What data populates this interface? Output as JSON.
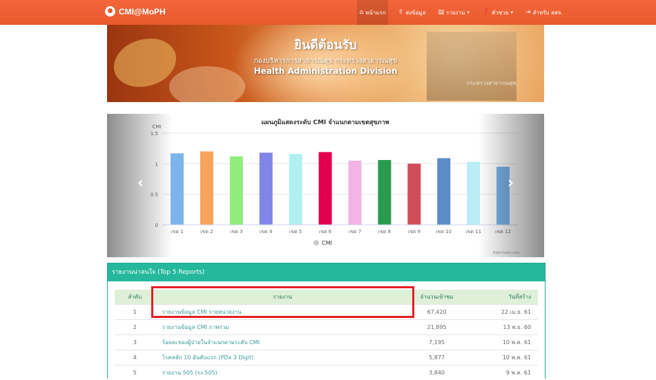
{
  "navbar": {
    "brand": "CMI@MoPH",
    "items": [
      {
        "icon": "home-icon",
        "glyph": "⌂",
        "label": "หน้าแรก",
        "caret": false,
        "active": true
      },
      {
        "icon": "upload-icon",
        "glyph": "⇧",
        "label": "ส่งข้อมูล",
        "caret": false,
        "active": false
      },
      {
        "icon": "file-icon",
        "glyph": "▤",
        "label": "รายงาน",
        "caret": true,
        "active": false
      },
      {
        "icon": "help-icon",
        "glyph": "❓",
        "label": "ตัวช่วย",
        "caret": true,
        "active": false
      },
      {
        "icon": "login-icon",
        "glyph": "⇥",
        "label": "สำหรับ สสจ.",
        "caret": false,
        "active": false
      }
    ]
  },
  "banner": {
    "title": "ยินดีต้อนรับ",
    "subtitle": "กองบริหารการสาธารณสุข กระทรวงสาธารณสุข",
    "english": "Health Administration Division",
    "sign": "กระทรวงสาธารณสุข"
  },
  "chart_data": {
    "type": "bar",
    "title": "แผนภูมิแสดงระดับ CMI จำแนกตามเขตสุขภาพ",
    "ylabel": "CMI",
    "ylim": [
      0,
      1.5
    ],
    "yticks": [
      "0",
      "0.5",
      "1",
      "1.5"
    ],
    "categories": [
      "เขต 1",
      "เขต 2",
      "เขต 3",
      "เขต 4",
      "เขต 5",
      "เขต 6",
      "เขต 7",
      "เขต 8",
      "เขต 9",
      "เขต 10",
      "เขต 11",
      "เขต 12"
    ],
    "values": [
      1.17,
      1.2,
      1.12,
      1.18,
      1.16,
      1.19,
      1.05,
      1.06,
      1.0,
      1.09,
      1.03,
      0.95
    ],
    "colors": [
      "#7cb5ec",
      "#f7a35c",
      "#90ed7d",
      "#8085e9",
      "#b2eff0",
      "#e4004f",
      "#f2b4e6",
      "#2b9a4d",
      "#d14d57",
      "#5b8cc8",
      "#b9ecf4",
      "#7cb5ec"
    ],
    "series": [
      {
        "name": "CMI"
      }
    ],
    "credit": "Highcharts.com",
    "grid": true,
    "legend": "bottom-center"
  },
  "top_reports": {
    "title": "รายงานน่าสนใจ (Top 5 Reports)",
    "headers": {
      "no": "ลำดับ",
      "name": "รายงาน",
      "views": "จำนวนเข้าชม",
      "date": "วันที่สร้าง"
    },
    "rows": [
      {
        "no": "1",
        "name": "รายงานข้อมูล CMI รายหน่วยงาน",
        "views": "67,420",
        "date": "22 เม.ย. 61"
      },
      {
        "no": "2",
        "name": "รายงานข้อมูล CMI ภาพรวม",
        "views": "21,895",
        "date": "13 พ.ย. 60"
      },
      {
        "no": "3",
        "name": "ร้อยละของผู้ป่วยในจำแนกตามระดับ CMI",
        "views": "7,195",
        "date": "10 พ.ค. 61"
      },
      {
        "no": "4",
        "name": "โรคหลัก 10 อันดับแรก (PDx 3 Digit)",
        "views": "5,877",
        "date": "10 พ.ค. 61"
      },
      {
        "no": "5",
        "name": "รายงาน 505 (รง.505)",
        "views": "3,840",
        "date": "9 พ.ค. 61"
      }
    ]
  }
}
